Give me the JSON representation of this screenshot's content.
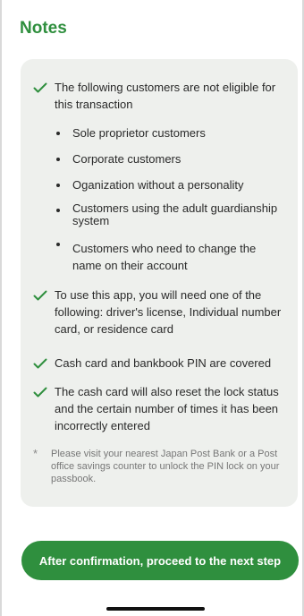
{
  "title": "Notes",
  "colors": {
    "accent": "#2f8f3e",
    "card_bg": "#eef0ed"
  },
  "items": [
    {
      "icon": "check-icon",
      "text": "The following customers are not eligible for this transaction"
    },
    {
      "icon": "check-icon",
      "text": "To use this app, you will need one of the following: driver's license, Individual number card, or residence card"
    },
    {
      "icon": "check-icon",
      "text": "Cash card and bankbook PIN are covered"
    },
    {
      "icon": "check-icon",
      "text": "The cash card will also reset the lock status and the certain number of times it has been incorrectly entered"
    }
  ],
  "ineligible": [
    "Sole proprietor customers",
    "Corporate customers",
    "Oganization without a personality",
    "Customers using the adult guardianship system",
    "Customers who need to change the name on their account"
  ],
  "note": {
    "symbol": "*",
    "text": "Please visit your nearest Japan Post Bank or a Post office savings counter to unlock the PIN lock on your passbook."
  },
  "cta_label": "After confirmation, proceed to the next step"
}
